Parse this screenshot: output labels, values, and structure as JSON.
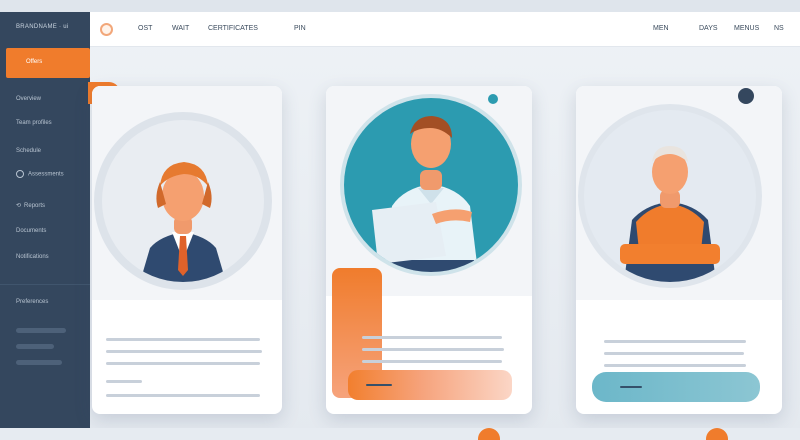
{
  "sidebar": {
    "brand": "BRANDNAME  ·  ui",
    "active_item": "Offers",
    "items": [
      {
        "label": "Overview",
        "icon": "none"
      },
      {
        "label": "Team  profiles",
        "icon": "none"
      },
      {
        "label": "Schedule",
        "icon": "none"
      },
      {
        "label": "Assessments",
        "icon": "circle-icon"
      },
      {
        "label": "Reports",
        "icon": "link-icon"
      },
      {
        "label": "Documents",
        "icon": "none"
      },
      {
        "label": "Notifications",
        "icon": "none"
      }
    ],
    "footer_label": "Preferences"
  },
  "topbar": {
    "nav_left": [
      "OST",
      "WAIT",
      "CERTIFICATES",
      "PIN"
    ],
    "nav_right": [
      "MEN",
      "DAYS",
      "MENUS",
      "NS"
    ]
  },
  "colors": {
    "accent_orange": "#f07c2c",
    "teal": "#2c9bb0",
    "navy": "#34475e",
    "light_teal": "#8cc6d3"
  }
}
